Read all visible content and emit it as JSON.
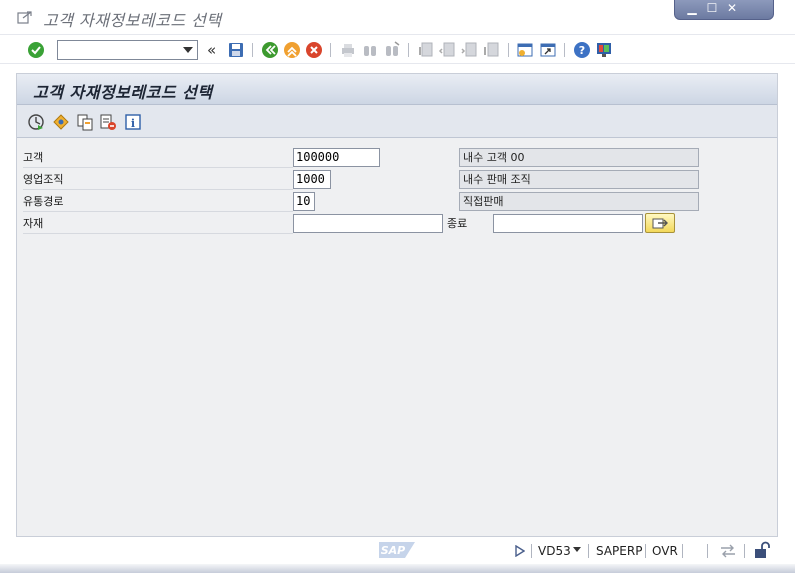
{
  "window": {
    "title": "고객 자재정보레코드 선택",
    "controls": {
      "minimize": "minimize-icon",
      "maximize": "maximize-icon",
      "close": "close-icon"
    }
  },
  "systoolbar": {
    "command_field": {
      "value": "",
      "placeholder": ""
    },
    "icons": [
      "enter-icon",
      "back-icon",
      "exit-icon",
      "cancel-icon",
      "save-icon",
      "print-icon",
      "find-icon",
      "find-next-icon",
      "first-page-icon",
      "previous-page-icon",
      "next-page-icon",
      "last-page-icon",
      "create-session-icon",
      "shortcut-icon",
      "help-icon",
      "customize-layout-icon"
    ]
  },
  "screen": {
    "title": "고객 자재정보레코드 선택",
    "app_icons": [
      "execute-icon",
      "get-variant-icon",
      "copy-selection-icon",
      "delete-selection-icon",
      "info-icon"
    ]
  },
  "form": {
    "customer": {
      "label": "고객",
      "value": "100000",
      "description": "내수 고객 00"
    },
    "sales_org": {
      "label": "영업조직",
      "value": "1000",
      "description": "내수 판매 조직"
    },
    "distribution_channel": {
      "label": "유통경로",
      "value": "10",
      "description": "직접판매"
    },
    "material": {
      "label": "자재",
      "value_from": "",
      "to_label": "종료",
      "value_to": ""
    }
  },
  "statusbar": {
    "logo": "SAP",
    "transaction": "VD53",
    "system": "SAPERP",
    "mode": "OVR"
  },
  "colors": {
    "enter_green": "#3aa236",
    "back_green": "#3d9a2f",
    "exit_orange": "#f0a030",
    "cancel_red": "#d9452c",
    "header_blue": "#cdd6e4",
    "multisel_yellow": "#f3d85a"
  }
}
